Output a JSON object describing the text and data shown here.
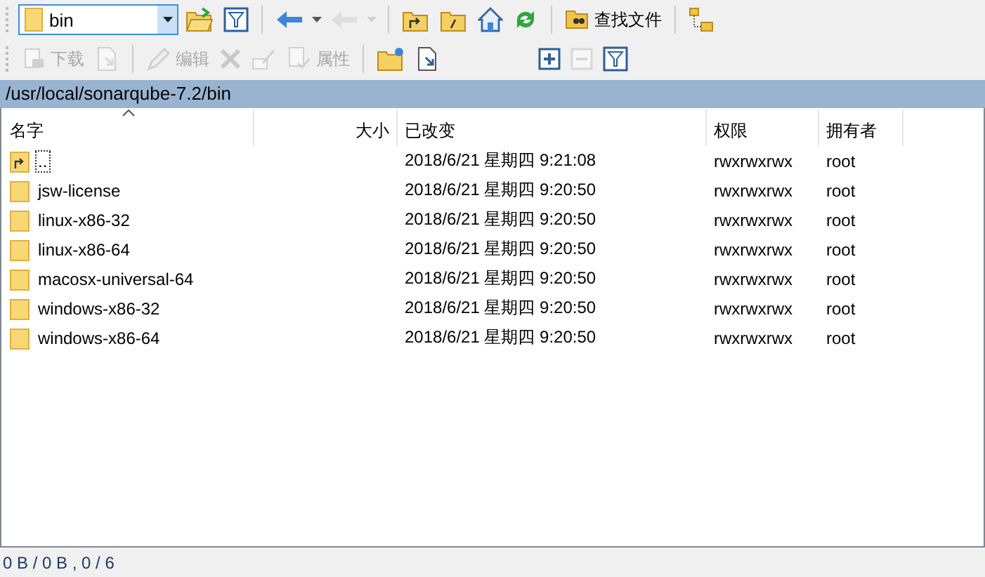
{
  "toolbars": [
    {
      "items": [
        {
          "kind": "path-combo",
          "label": "bin"
        },
        {
          "kind": "open-folder",
          "disabled": false
        },
        {
          "kind": "filter",
          "disabled": false
        },
        {
          "kind": "sep"
        },
        {
          "kind": "back",
          "disabled": false
        },
        {
          "kind": "caret",
          "disabled": false
        },
        {
          "kind": "forward",
          "disabled": true
        },
        {
          "kind": "caret",
          "disabled": true
        },
        {
          "kind": "sep"
        },
        {
          "kind": "parent-folder",
          "disabled": false
        },
        {
          "kind": "root-folder",
          "disabled": false
        },
        {
          "kind": "home",
          "disabled": false
        },
        {
          "kind": "refresh",
          "disabled": false
        },
        {
          "kind": "sep"
        },
        {
          "kind": "find",
          "label": "查找文件",
          "disabled": false
        },
        {
          "kind": "sep"
        },
        {
          "kind": "tree",
          "disabled": false
        }
      ]
    },
    {
      "items": [
        {
          "kind": "download",
          "label": "下载",
          "disabled": true
        },
        {
          "kind": "download-options",
          "disabled": true
        },
        {
          "kind": "sep"
        },
        {
          "kind": "edit",
          "label": "编辑",
          "disabled": true
        },
        {
          "kind": "delete",
          "disabled": true
        },
        {
          "kind": "rename",
          "disabled": true
        },
        {
          "kind": "properties",
          "label": "属性",
          "disabled": true
        },
        {
          "kind": "sep"
        },
        {
          "kind": "new-folder",
          "disabled": false
        },
        {
          "kind": "add-link",
          "disabled": false
        },
        {
          "kind": "gap"
        },
        {
          "kind": "plus",
          "disabled": false
        },
        {
          "kind": "minus",
          "disabled": true
        },
        {
          "kind": "select-filter",
          "disabled": false
        }
      ]
    }
  ],
  "path": "/usr/local/sonarqube-7.2/bin",
  "columns": [
    {
      "label": "名字",
      "sorted": true
    },
    {
      "label": "大小",
      "sorted": false
    },
    {
      "label": "已改变",
      "sorted": false
    },
    {
      "label": "权限",
      "sorted": false
    },
    {
      "label": "拥有者",
      "sorted": false
    }
  ],
  "rows": [
    {
      "kind": "parent",
      "name": "..",
      "focused": true,
      "changed": "2018/6/21 星期四 9:21:08",
      "rights": "rwxrwxrwx",
      "owner": "root"
    },
    {
      "kind": "folder",
      "name": "jsw-license",
      "focused": false,
      "changed": "2018/6/21 星期四 9:20:50",
      "rights": "rwxrwxrwx",
      "owner": "root"
    },
    {
      "kind": "folder",
      "name": "linux-x86-32",
      "focused": false,
      "changed": "2018/6/21 星期四 9:20:50",
      "rights": "rwxrwxrwx",
      "owner": "root"
    },
    {
      "kind": "folder",
      "name": "linux-x86-64",
      "focused": false,
      "changed": "2018/6/21 星期四 9:20:50",
      "rights": "rwxrwxrwx",
      "owner": "root"
    },
    {
      "kind": "folder",
      "name": "macosx-universal-64",
      "focused": false,
      "changed": "2018/6/21 星期四 9:20:50",
      "rights": "rwxrwxrwx",
      "owner": "root"
    },
    {
      "kind": "folder",
      "name": "windows-x86-32",
      "focused": false,
      "changed": "2018/6/21 星期四 9:20:50",
      "rights": "rwxrwxrwx",
      "owner": "root"
    },
    {
      "kind": "folder",
      "name": "windows-x86-64",
      "focused": false,
      "changed": "2018/6/21 星期四 9:20:50",
      "rights": "rwxrwxrwx",
      "owner": "root"
    }
  ],
  "status": "0 B / 0 B , 0 / 6"
}
